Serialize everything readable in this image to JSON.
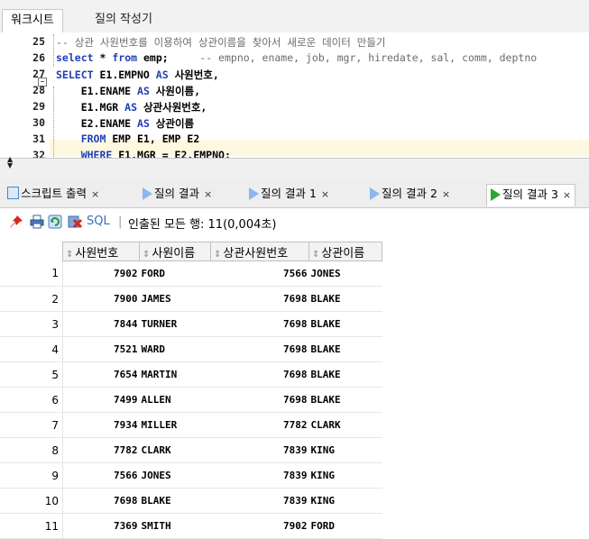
{
  "top_tabs": {
    "worksheet": "워크시트",
    "query_builder": "질의 작성기"
  },
  "editor": {
    "lines": [
      {
        "num": "25",
        "parts": [
          {
            "t": "-- 상관 사원번호를 이용하여 상관이름을 찾아서 새로운 데이터 만들기",
            "c": "cm"
          }
        ]
      },
      {
        "num": "26",
        "parts": [
          {
            "t": "select",
            "c": "kw"
          },
          {
            "t": " ",
            "c": ""
          },
          {
            "t": "*",
            "c": ""
          },
          {
            "t": " from ",
            "c": "kw"
          },
          {
            "t": "emp;",
            "c": ""
          },
          {
            "t": "     -- empno, ename, job, mgr, hiredate, sal, comm, deptno",
            "c": "cm"
          }
        ]
      },
      {
        "num": "27",
        "parts": [
          {
            "t": "SELECT ",
            "c": "kw"
          },
          {
            "t": "E1.EMPNO ",
            "c": ""
          },
          {
            "t": "AS ",
            "c": "kw"
          },
          {
            "t": "사원번호,",
            "c": ""
          }
        ]
      },
      {
        "num": "28",
        "parts": [
          {
            "t": "    E1.ENAME ",
            "c": ""
          },
          {
            "t": "AS ",
            "c": "kw"
          },
          {
            "t": "사원이름,",
            "c": ""
          }
        ]
      },
      {
        "num": "29",
        "parts": [
          {
            "t": "    E1.MGR ",
            "c": ""
          },
          {
            "t": "AS ",
            "c": "kw"
          },
          {
            "t": "상관사원번호,",
            "c": ""
          }
        ]
      },
      {
        "num": "30",
        "parts": [
          {
            "t": "    E2.ENAME ",
            "c": ""
          },
          {
            "t": "AS ",
            "c": "kw"
          },
          {
            "t": "상관이름",
            "c": ""
          }
        ]
      },
      {
        "num": "31",
        "parts": [
          {
            "t": "    FROM ",
            "c": "kw"
          },
          {
            "t": "EMP E1, EMP E2",
            "c": ""
          }
        ]
      },
      {
        "num": "32",
        "parts": [
          {
            "t": "    WHERE ",
            "c": "kw"
          },
          {
            "t": "E1.MGR = E2.EMPNO;",
            "c": ""
          }
        ]
      }
    ]
  },
  "result_tabs": [
    {
      "label": "스크립트 출력",
      "close": "×"
    },
    {
      "label": "질의 결과",
      "close": "×"
    },
    {
      "label": "질의 결과 1",
      "close": "×"
    },
    {
      "label": "질의 결과 2",
      "close": "×"
    },
    {
      "label": "질의 결과 3",
      "close": "×"
    }
  ],
  "toolbar": {
    "sql": "SQL",
    "separator": "|",
    "fetched": "인출된 모든 행: 11(0,004초)"
  },
  "grid": {
    "columns": [
      "사원번호",
      "사원이름",
      "상관사원번호",
      "상관이름"
    ],
    "rows": [
      [
        "1",
        "7902",
        "FORD",
        "7566",
        "JONES"
      ],
      [
        "2",
        "7900",
        "JAMES",
        "7698",
        "BLAKE"
      ],
      [
        "3",
        "7844",
        "TURNER",
        "7698",
        "BLAKE"
      ],
      [
        "4",
        "7521",
        "WARD",
        "7698",
        "BLAKE"
      ],
      [
        "5",
        "7654",
        "MARTIN",
        "7698",
        "BLAKE"
      ],
      [
        "6",
        "7499",
        "ALLEN",
        "7698",
        "BLAKE"
      ],
      [
        "7",
        "7934",
        "MILLER",
        "7782",
        "CLARK"
      ],
      [
        "8",
        "7782",
        "CLARK",
        "7839",
        "KING"
      ],
      [
        "9",
        "7566",
        "JONES",
        "7839",
        "KING"
      ],
      [
        "10",
        "7698",
        "BLAKE",
        "7839",
        "KING"
      ],
      [
        "11",
        "7369",
        "SMITH",
        "7902",
        "FORD"
      ]
    ]
  }
}
